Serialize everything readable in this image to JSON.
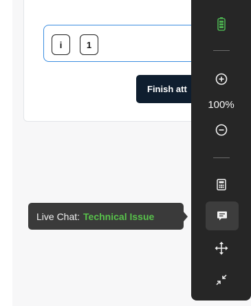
{
  "question": {
    "keys": [
      "i",
      "1"
    ],
    "finish_label": "Finish att"
  },
  "toolbar": {
    "zoom_level": "100%",
    "icons": [
      "battery-icon",
      "zoom-in-icon",
      "zoom-out-icon",
      "calculator-icon",
      "live-chat-icon",
      "move-icon",
      "minimize-icon"
    ]
  },
  "tooltip": {
    "prefix": "Live Chat:",
    "status": "Technical Issue"
  },
  "colors": {
    "toolbar_bg": "#262626",
    "battery": "#4caf50",
    "status_text": "#58c24b",
    "finish_button": "#0f1e2f",
    "answer_border": "#3a8de0"
  }
}
